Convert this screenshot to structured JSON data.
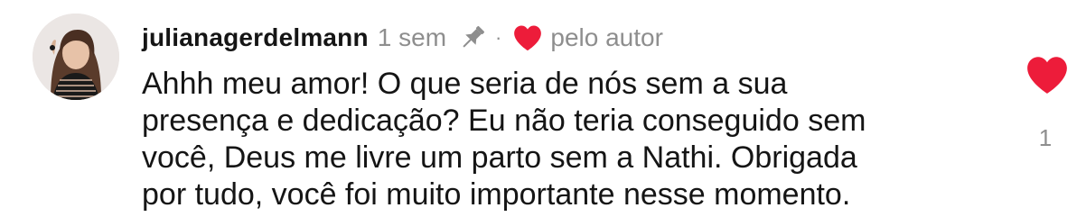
{
  "comment": {
    "username": "julianagerdelmann",
    "time": "1 sem",
    "separator": "·",
    "author_badge": "pelo autor",
    "lines": [
      "Ahhh meu amor! O que seria de nós sem a sua",
      "presença e dedicação? Eu não teria conseguido sem",
      "você, Deus me livre um parto sem a Nathi. Obrigada",
      "por tudo, você foi muito importante nesse momento."
    ],
    "like_count": "1"
  },
  "icons": {
    "pin": "pin-icon",
    "author_heart": "heart-icon",
    "like": "heart-icon"
  },
  "colors": {
    "heart": "#ed1c3a",
    "muted": "#8e8e8e",
    "text": "#151515"
  }
}
